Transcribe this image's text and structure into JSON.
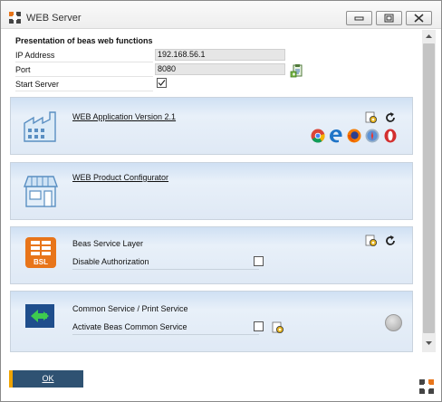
{
  "window": {
    "title": "WEB Server",
    "icons": {
      "app": "beas-logo-icon",
      "minimize": "minimize-icon",
      "maximize": "maximize-icon",
      "close": "close-icon"
    }
  },
  "form": {
    "heading": "Presentation of beas web functions",
    "ip_label": "IP Address",
    "ip_value": "192.168.56.1",
    "port_label": "Port",
    "port_value": "8080",
    "start_server_label": "Start Server",
    "start_server_checked": true,
    "copy_icon": "copy-clipboard-icon"
  },
  "panels": {
    "web_application": {
      "link": "WEB Application Version 2.1",
      "icon": "factory-icon",
      "actions": [
        "settings-gear-icon",
        "refresh-icon"
      ],
      "browsers": [
        "chrome-icon",
        "edge-icon",
        "firefox-icon",
        "safari-icon",
        "opera-icon"
      ]
    },
    "product_configurator": {
      "link": "WEB Product Configurator",
      "icon": "store-icon"
    },
    "service_layer": {
      "title": "Beas Service Layer",
      "icon": "bsl-icon",
      "icon_text": "BSL",
      "option_label": "Disable Authorization",
      "option_checked": false,
      "actions": [
        "settings-gear-icon",
        "refresh-icon"
      ]
    },
    "common_service": {
      "title": "Common Service / Print Service",
      "icon": "transfer-icon",
      "option_label": "Activate Beas Common Service",
      "option_checked": false,
      "actions": [
        "settings-gear-icon"
      ],
      "status": "inactive"
    }
  },
  "footer": {
    "ok_label": "OK",
    "brand_icon": "beas-logo-icon"
  },
  "colors": {
    "panel_top": "#cfe0f3",
    "panel_bottom": "#dfe9f5",
    "ok_button": "#2f5272",
    "ok_accent": "#f0a400",
    "brand_orange": "#e8751a"
  }
}
